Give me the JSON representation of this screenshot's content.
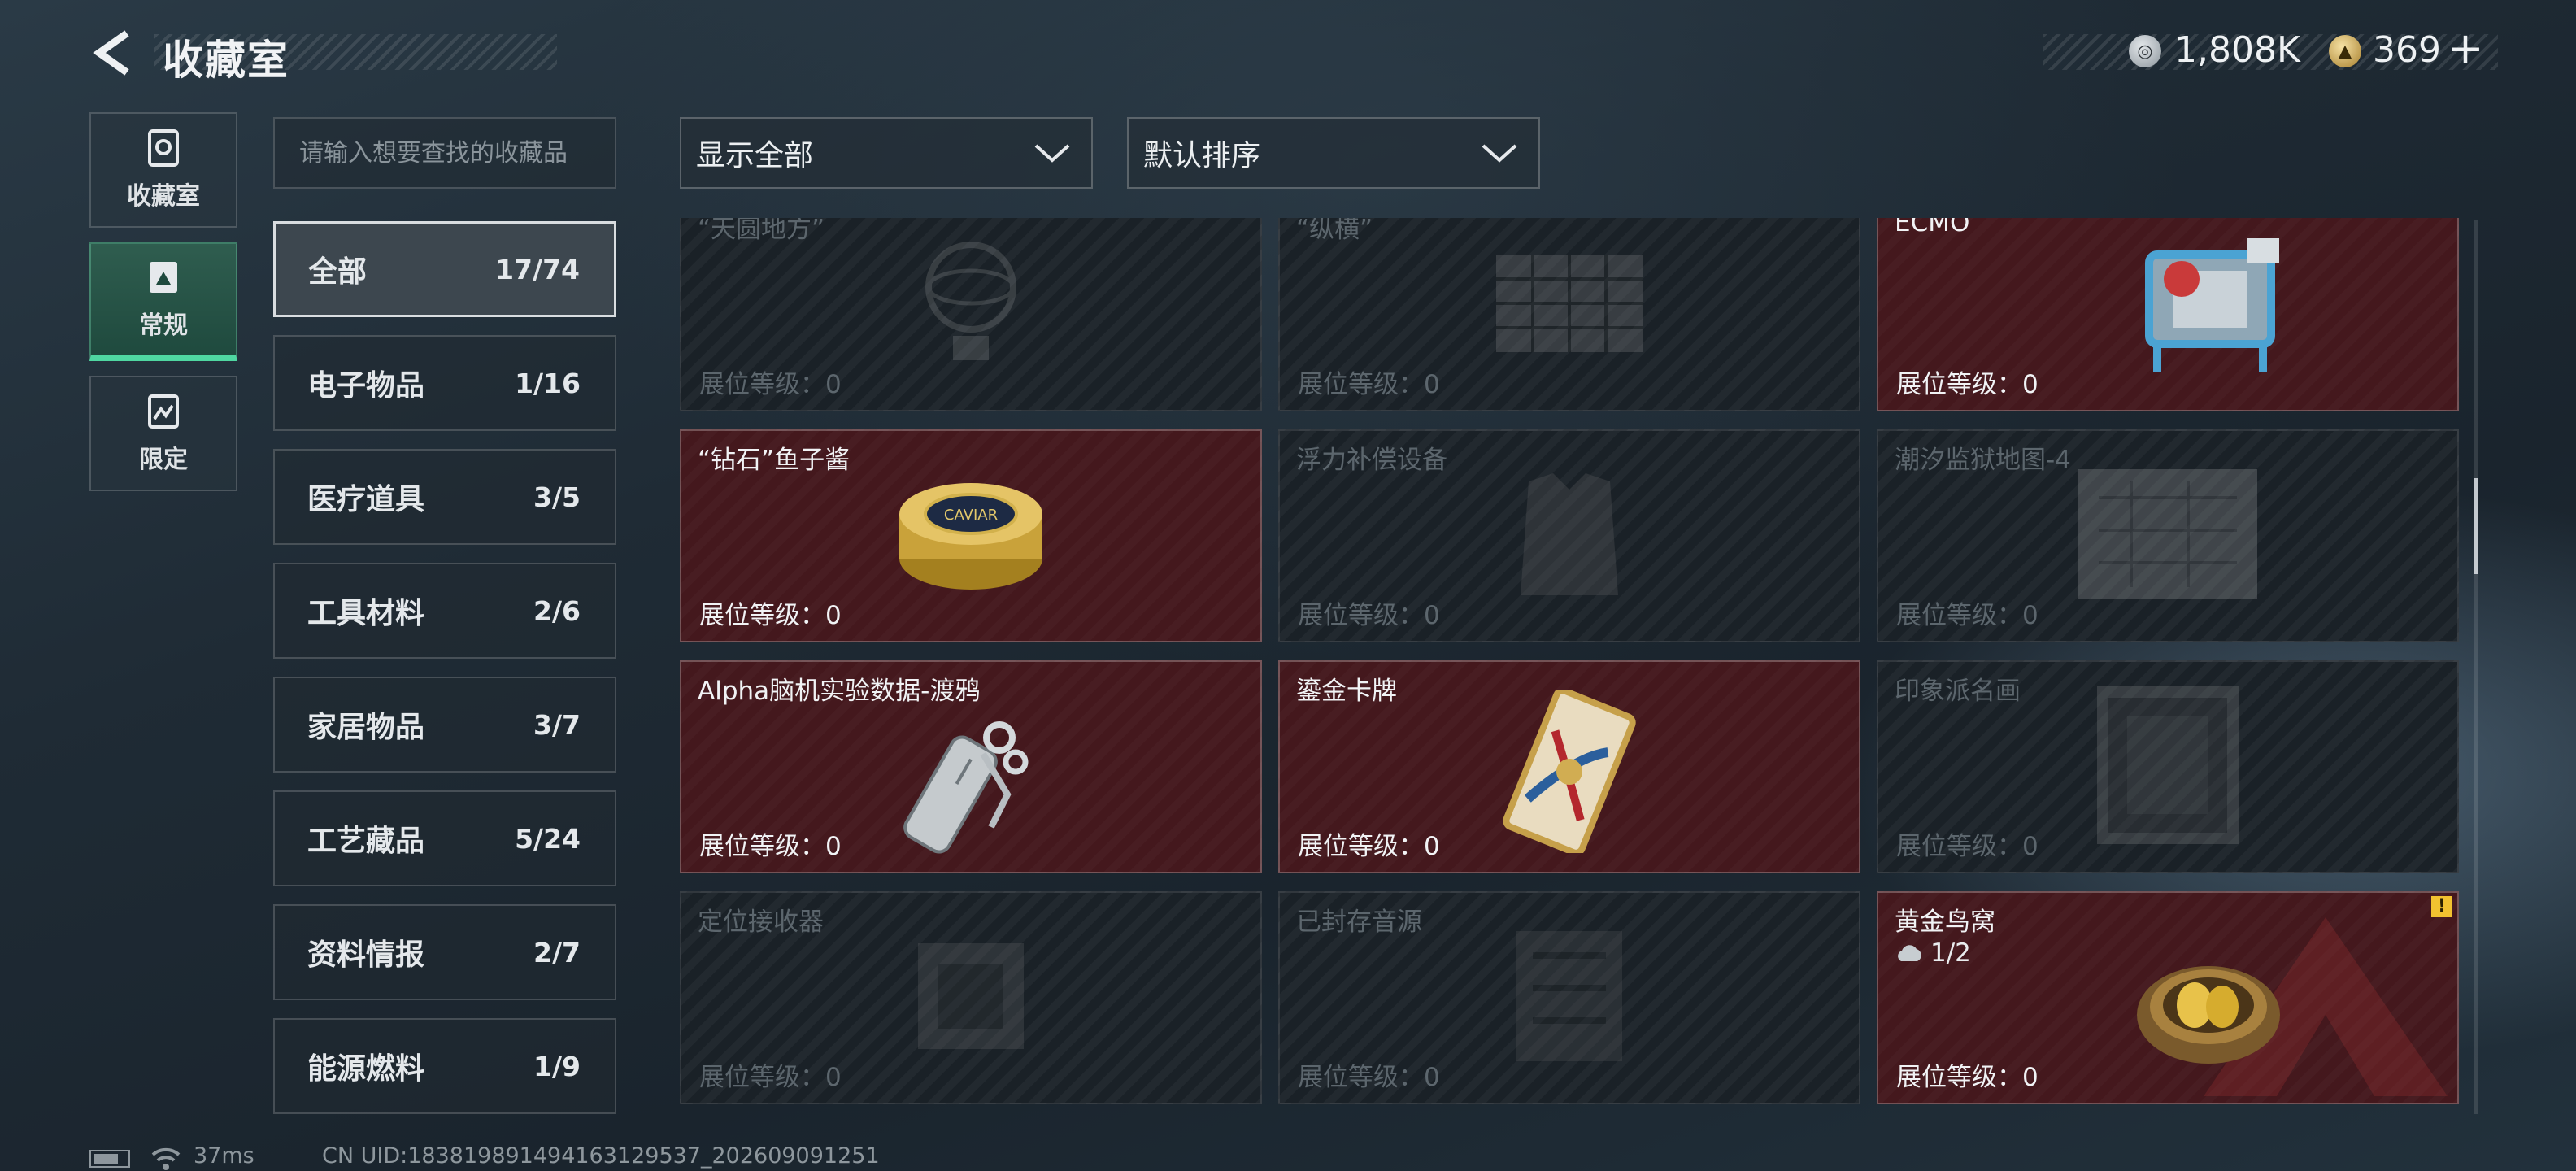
{
  "header": {
    "title": "收藏室",
    "currency": [
      {
        "icon": "silver-coin-icon",
        "value": "1,808K"
      },
      {
        "icon": "gold-gem-icon",
        "value": "369"
      }
    ],
    "add_label": "+"
  },
  "rail": [
    {
      "icon": "collection-room-icon",
      "label": "收藏室"
    },
    {
      "icon": "regular-icon",
      "label": "常规",
      "active": true
    },
    {
      "icon": "limited-icon",
      "label": "限定"
    }
  ],
  "search": {
    "placeholder": "请输入想要查找的收藏品",
    "value": ""
  },
  "categories": [
    {
      "name": "全部",
      "count": "17/74",
      "active": true
    },
    {
      "name": "电子物品",
      "count": "1/16"
    },
    {
      "name": "医疗道具",
      "count": "3/5"
    },
    {
      "name": "工具材料",
      "count": "2/6"
    },
    {
      "name": "家居物品",
      "count": "3/7"
    },
    {
      "name": "工艺藏品",
      "count": "5/24"
    },
    {
      "name": "资料情报",
      "count": "2/7"
    },
    {
      "name": "能源燃料",
      "count": "1/9"
    }
  ],
  "filters": {
    "show": "显示全部",
    "sort": "默认排序"
  },
  "items": [
    {
      "name": "“天圆地方”",
      "level": "展位等级：0",
      "owned": false,
      "art": "globe"
    },
    {
      "name": "“纵横”",
      "level": "展位等级：0",
      "owned": false,
      "art": "chessboard"
    },
    {
      "name": "ECMO",
      "level": "展位等级：0",
      "owned": true,
      "art": "ecmo"
    },
    {
      "name": "“钻石”鱼子酱",
      "level": "展位等级：0",
      "owned": true,
      "art": "caviar"
    },
    {
      "name": "浮力补偿设备",
      "level": "展位等级：0",
      "owned": false,
      "art": "vest"
    },
    {
      "name": "潮汐监狱地图-4",
      "level": "展位等级：0",
      "owned": false,
      "art": "map"
    },
    {
      "name": "Alpha脑机实验数据-渡鸦",
      "level": "展位等级：0",
      "owned": true,
      "art": "usb"
    },
    {
      "name": "鎏金卡牌",
      "level": "展位等级：0",
      "owned": true,
      "art": "card"
    },
    {
      "name": "印象派名画",
      "level": "展位等级：0",
      "owned": false,
      "art": "painting"
    },
    {
      "name": "定位接收器",
      "level": "展位等级：0",
      "owned": false,
      "art": "receiver"
    },
    {
      "name": "已封存音源",
      "level": "展位等级：0",
      "owned": false,
      "art": "board"
    },
    {
      "name": "黄金鸟窝",
      "level": "展位等级：0",
      "owned": true,
      "art": "nest",
      "progress": "1/2",
      "alert": "!"
    }
  ],
  "footer": {
    "ping": "37ms",
    "uid": "CN UID:18381989149416312953​7_202609091251"
  }
}
